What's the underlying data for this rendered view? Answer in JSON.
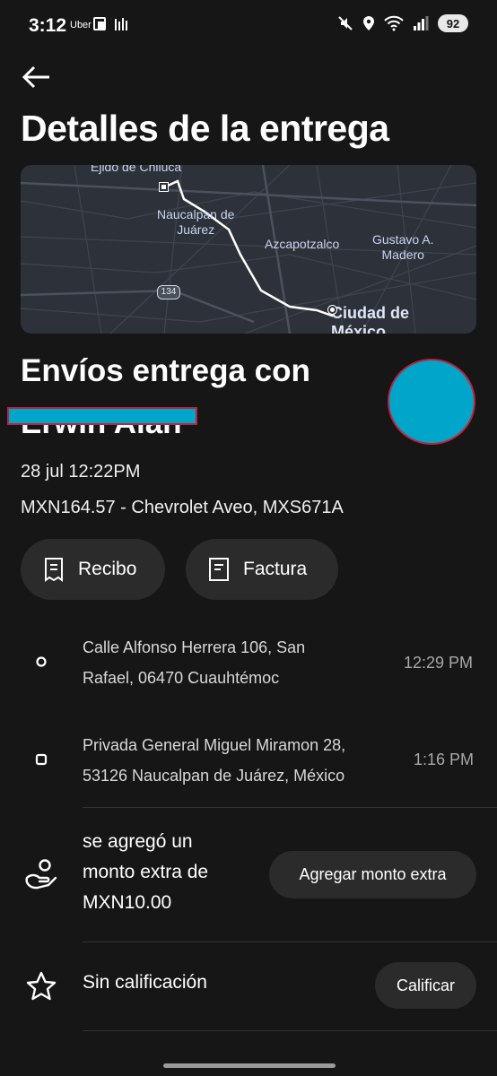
{
  "status_bar": {
    "time": "3:12",
    "app_indicator": "Uber",
    "battery": "92",
    "icons": [
      "mute-icon",
      "location-icon",
      "wifi-icon",
      "signal-icon"
    ]
  },
  "header": {
    "title": "Detalles de la entrega"
  },
  "map": {
    "labels": {
      "ejido": "Ejido de Chiluca",
      "naucalpan": "Naucalpan de\nJuárez",
      "azcapotzalco": "Azcapotzalco",
      "gustavo": "Gustavo A.\nMadero",
      "highway": "134",
      "ciudad": "Ciudad de\nMéxico"
    }
  },
  "trip": {
    "heading": "Envíos entrega con",
    "driver_name": "Erwin Alan",
    "date": "28 jul 12:22PM",
    "fare_vehicle": "MXN164.57 - Chevrolet Aveo, MXS671A"
  },
  "actions": {
    "receipt_label": "Recibo",
    "invoice_label": "Factura"
  },
  "stops": [
    {
      "address_line1": "Calle Alfonso Herrera 106, San",
      "address_line2": "Rafael, 06470 Cuauhtémoc",
      "time": "12:29 PM"
    },
    {
      "address_line1": "Privada General Miguel Miramon 28,",
      "address_line2": "53126 Naucalpan de Juárez, México",
      "time": "1:16 PM"
    }
  ],
  "tip": {
    "line1": "se agregó un",
    "line2": "monto extra de",
    "line3": "MXN10.00",
    "button_label": "Agregar monto extra"
  },
  "rating": {
    "text": "Sin calificación",
    "button_label": "Calificar"
  },
  "colors": {
    "background": "#161616",
    "pill": "#2b2b2b",
    "redaction": "#00a6c9",
    "redaction_border": "#c0223a"
  }
}
